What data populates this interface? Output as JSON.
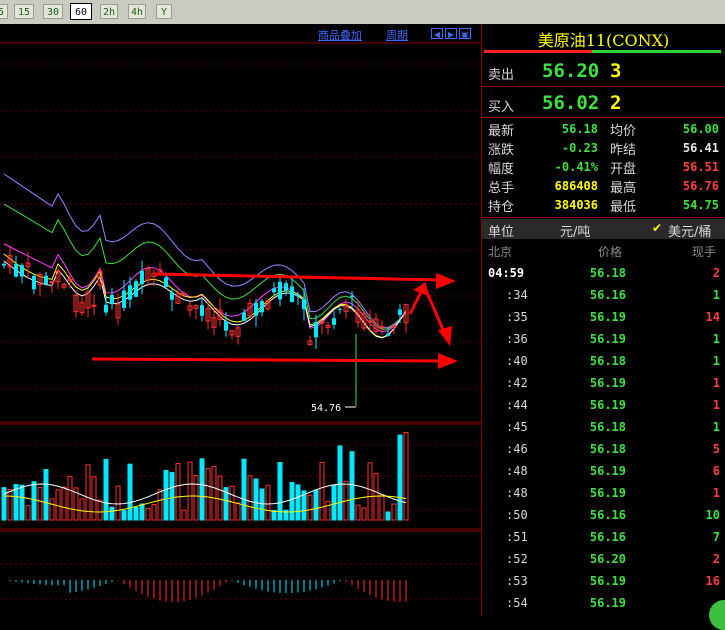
{
  "toolbar": {
    "buttons": [
      {
        "label": "5",
        "active": false
      },
      {
        "label": "15",
        "active": false
      },
      {
        "label": "30",
        "active": false
      },
      {
        "label": "60",
        "active": true
      },
      {
        "label": "2h",
        "active": false
      },
      {
        "label": "4h",
        "active": false
      },
      {
        "label": "Y",
        "active": false
      }
    ]
  },
  "chart_header": {
    "overlay_link": "商品叠加",
    "period_link": "周期"
  },
  "chart": {
    "low_marker": "54.76"
  },
  "quote": {
    "title": "美原油11(CONX)",
    "sell": {
      "label": "卖出",
      "price": "56.20",
      "qty": "3"
    },
    "buy": {
      "label": "买入",
      "price": "56.02",
      "qty": "2"
    },
    "stats": [
      {
        "l1": "最新",
        "v1": "56.18",
        "c1": "#3fe03f",
        "l2": "均价",
        "v2": "56.00",
        "c2": "#3fe03f"
      },
      {
        "l1": "涨跌",
        "v1": "-0.23",
        "c1": "#3fe03f",
        "l2": "昨结",
        "v2": "56.41",
        "c2": "#e8e8e8"
      },
      {
        "l1": "幅度",
        "v1": "-0.41%",
        "c1": "#3fe03f",
        "l2": "开盘",
        "v2": "56.51",
        "c2": "#ff4040"
      },
      {
        "l1": "总手",
        "v1": "686408",
        "c1": "#ffff00",
        "l2": "最高",
        "v2": "56.76",
        "c2": "#ff4040"
      },
      {
        "l1": "持仓",
        "v1": "384036",
        "c1": "#ffff00",
        "l2": "最低",
        "v2": "54.75",
        "c2": "#3fe03f"
      }
    ],
    "unit_row": {
      "label": "单位",
      "unit1": "元/吨",
      "unit2": "美元/桶"
    },
    "tick_header": {
      "time": "北京",
      "price": "价格",
      "vol": "现手"
    },
    "ticks": [
      {
        "time": "04:59",
        "price": "56.18",
        "vol": "2",
        "vc": "#ff4040"
      },
      {
        "time": ":34",
        "price": "56.16",
        "vol": "1",
        "vc": "#3fe03f"
      },
      {
        "time": ":35",
        "price": "56.19",
        "vol": "14",
        "vc": "#ff4040"
      },
      {
        "time": ":36",
        "price": "56.19",
        "vol": "1",
        "vc": "#3fe03f"
      },
      {
        "time": ":40",
        "price": "56.18",
        "vol": "1",
        "vc": "#3fe03f"
      },
      {
        "time": ":42",
        "price": "56.19",
        "vol": "1",
        "vc": "#ff4040"
      },
      {
        "time": ":44",
        "price": "56.19",
        "vol": "1",
        "vc": "#ff4040"
      },
      {
        "time": ":45",
        "price": "56.18",
        "vol": "1",
        "vc": "#3fe03f"
      },
      {
        "time": ":46",
        "price": "56.18",
        "vol": "5",
        "vc": "#ff4040"
      },
      {
        "time": ":48",
        "price": "56.19",
        "vol": "6",
        "vc": "#ff4040"
      },
      {
        "time": ":48",
        "price": "56.19",
        "vol": "1",
        "vc": "#ff4040"
      },
      {
        "time": ":50",
        "price": "56.16",
        "vol": "10",
        "vc": "#3fe03f"
      },
      {
        "time": ":51",
        "price": "56.16",
        "vol": "7",
        "vc": "#3fe03f"
      },
      {
        "time": ":52",
        "price": "56.20",
        "vol": "2",
        "vc": "#ff4040"
      },
      {
        "time": ":53",
        "price": "56.19",
        "vol": "16",
        "vc": "#ff4040"
      },
      {
        "time": ":54",
        "price": "56.19",
        "vol": "",
        "vc": "#3fe03f"
      }
    ]
  }
}
